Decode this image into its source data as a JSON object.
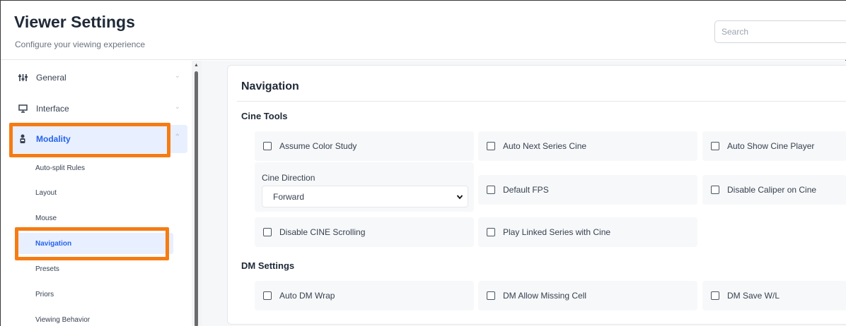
{
  "header": {
    "title": "Viewer Settings",
    "subtitle": "Configure your viewing experience",
    "search_placeholder": "Search"
  },
  "sidebar": {
    "items": [
      {
        "label": "General",
        "icon": "sliders-icon"
      },
      {
        "label": "Interface",
        "icon": "monitor-icon"
      },
      {
        "label": "Modality",
        "icon": "modality-icon",
        "active": true
      }
    ],
    "subitems": [
      {
        "label": "Auto-split Rules"
      },
      {
        "label": "Layout"
      },
      {
        "label": "Mouse"
      },
      {
        "label": "Navigation",
        "active": true
      },
      {
        "label": "Presets"
      },
      {
        "label": "Priors"
      },
      {
        "label": "Viewing Behavior"
      }
    ]
  },
  "main": {
    "section_title": "Navigation",
    "cine_tools": {
      "title": "Cine Tools",
      "assume_color_study": "Assume Color Study",
      "auto_next_series_cine": "Auto Next Series Cine",
      "auto_show_cine_player": "Auto Show Cine Player",
      "cine_direction_label": "Cine Direction",
      "cine_direction_value": "Forward",
      "default_fps": "Default FPS",
      "disable_caliper_on_cine": "Disable Caliper on Cine",
      "disable_cine_scrolling": "Disable CINE Scrolling",
      "play_linked_series_with_cine": "Play Linked Series with Cine"
    },
    "dm_settings": {
      "title": "DM Settings",
      "auto_dm_wrap": "Auto DM Wrap",
      "dm_allow_missing_cell": "DM Allow Missing Cell",
      "dm_save_wl": "DM Save W/L"
    }
  },
  "colors": {
    "highlight": "#f57c14",
    "active_text": "#2563eb",
    "active_bg": "#e8efff"
  }
}
